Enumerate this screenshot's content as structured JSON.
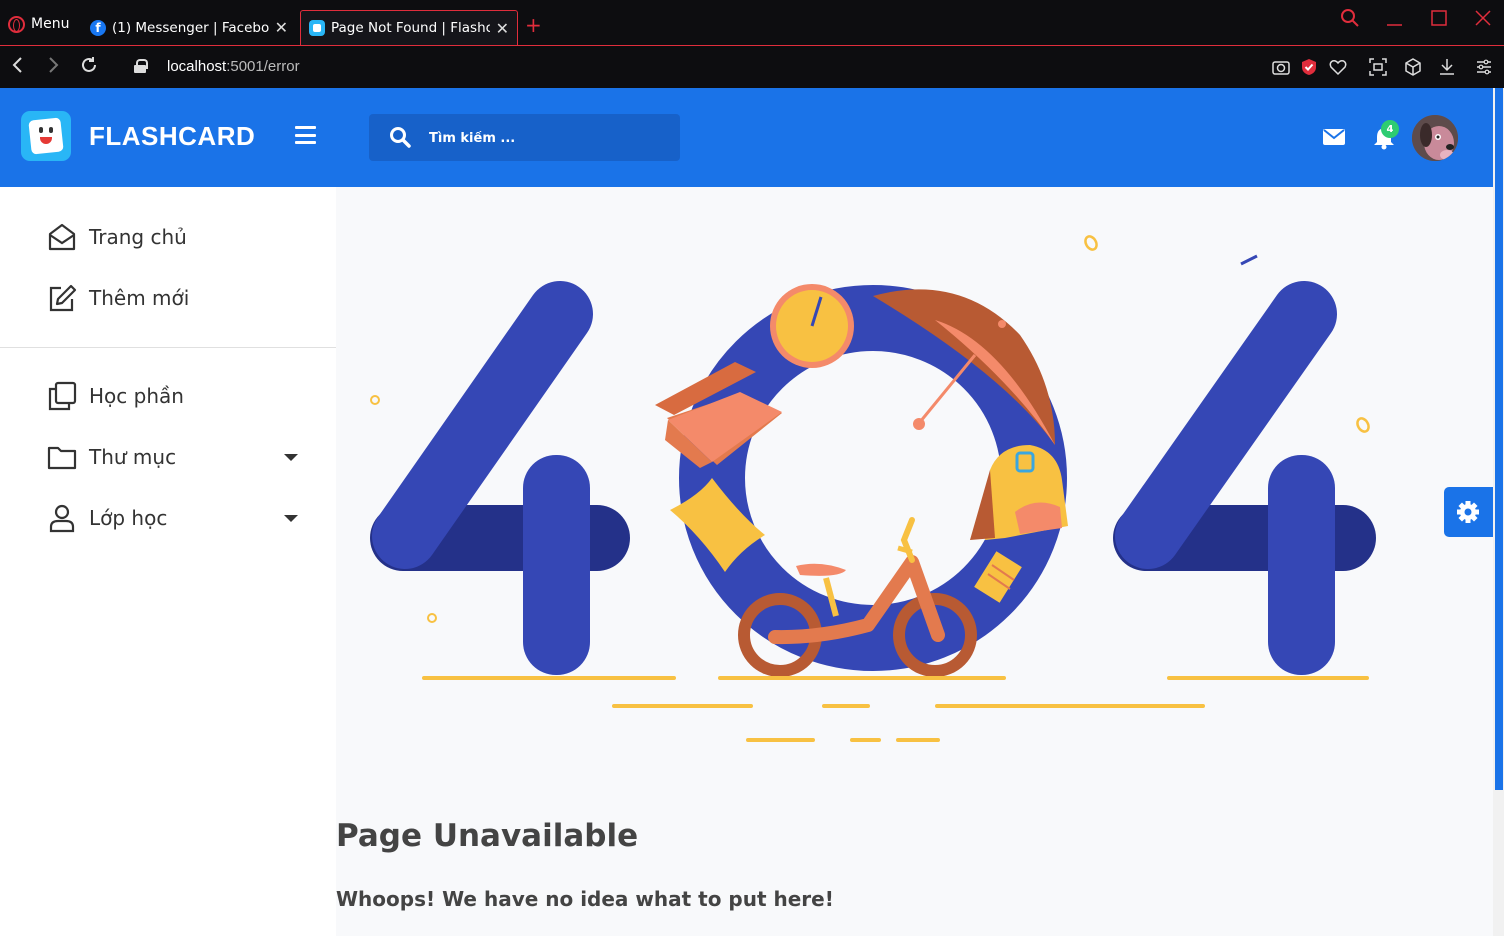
{
  "browser": {
    "menu_label": "Menu",
    "tabs": [
      {
        "title": "(1) Messenger | Facebook",
        "favicon": "facebook-icon"
      },
      {
        "title": "Page Not Found | Flashcard",
        "favicon": "flashcard-icon",
        "active": true
      }
    ],
    "url_host": "localhost",
    "url_path": ":5001/error",
    "accent_color": "#e02d3c"
  },
  "header": {
    "brand": "FLASHCARD",
    "search_placeholder": "Tìm kiếm ...",
    "notification_count": "4",
    "color": "#1a73e8"
  },
  "sidebar": {
    "items": [
      {
        "label": "Trang chủ",
        "icon": "house-envelope-icon"
      },
      {
        "label": "Thêm mới",
        "icon": "edit-icon"
      },
      {
        "label": "Học phần",
        "icon": "copy-icon"
      },
      {
        "label": "Thư mục",
        "icon": "folder-icon",
        "has_dropdown": true
      },
      {
        "label": "Lớp học",
        "icon": "user-icon",
        "has_dropdown": true
      }
    ]
  },
  "main": {
    "illustration_text": "404",
    "title": "Page Unavailable",
    "message": "Whoops! We have no idea what to put here!"
  }
}
